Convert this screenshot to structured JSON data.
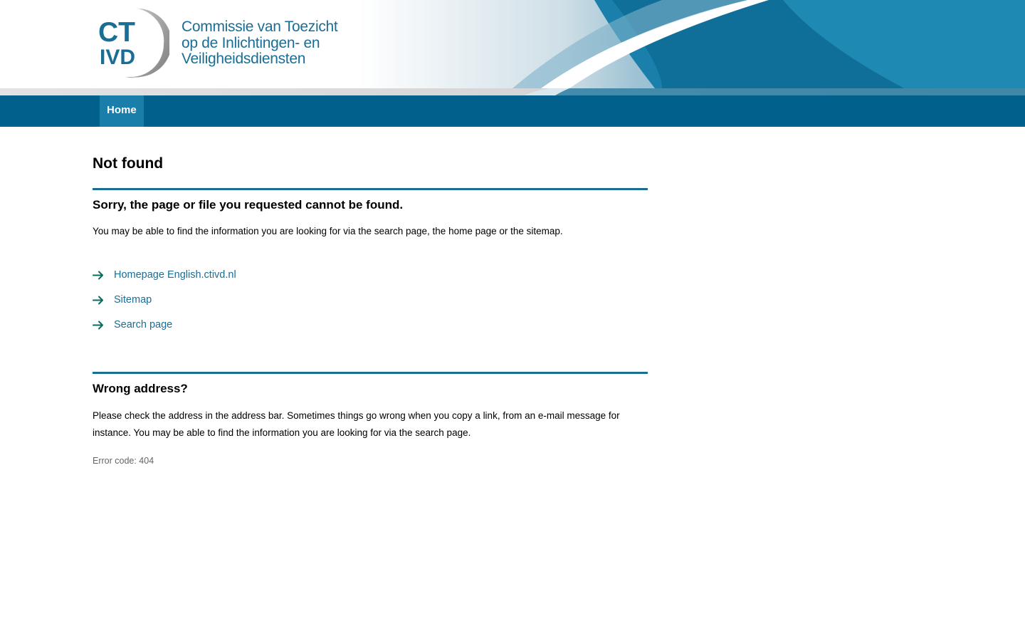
{
  "header": {
    "logo_mark_line1": "CT",
    "logo_mark_line2": "IVD",
    "org_name_lines": [
      "Commissie van Toezicht",
      "op de Inlichtingen- en",
      "Veiligheidsdiensten"
    ]
  },
  "nav": {
    "items": [
      {
        "label": "Home"
      }
    ]
  },
  "main": {
    "title": "Not found",
    "section1": {
      "heading": "Sorry, the page or file you requested cannot be found.",
      "text": "You may be able to find the information you are looking for via the search page, the home page or the sitemap.",
      "links": [
        {
          "label": "Homepage English.ctivd.nl",
          "icon": "arrow-right-icon"
        },
        {
          "label": "Sitemap",
          "icon": "arrow-right-icon"
        },
        {
          "label": "Search page",
          "icon": "arrow-right-icon"
        }
      ]
    },
    "section2": {
      "heading": "Wrong address?",
      "text": "Please check the address in the address bar. Sometimes things go wrong when you copy a link, from an e-mail message for instance. You may be able to find the information you are looking for via the search page."
    },
    "error_code": "Error code: 404"
  },
  "colors": {
    "nav_bg": "#02608d",
    "nav_active": "#1a7eab",
    "link": "#1a6d94",
    "rule": "#1b6d94",
    "arrow": "#0b6c5e"
  }
}
